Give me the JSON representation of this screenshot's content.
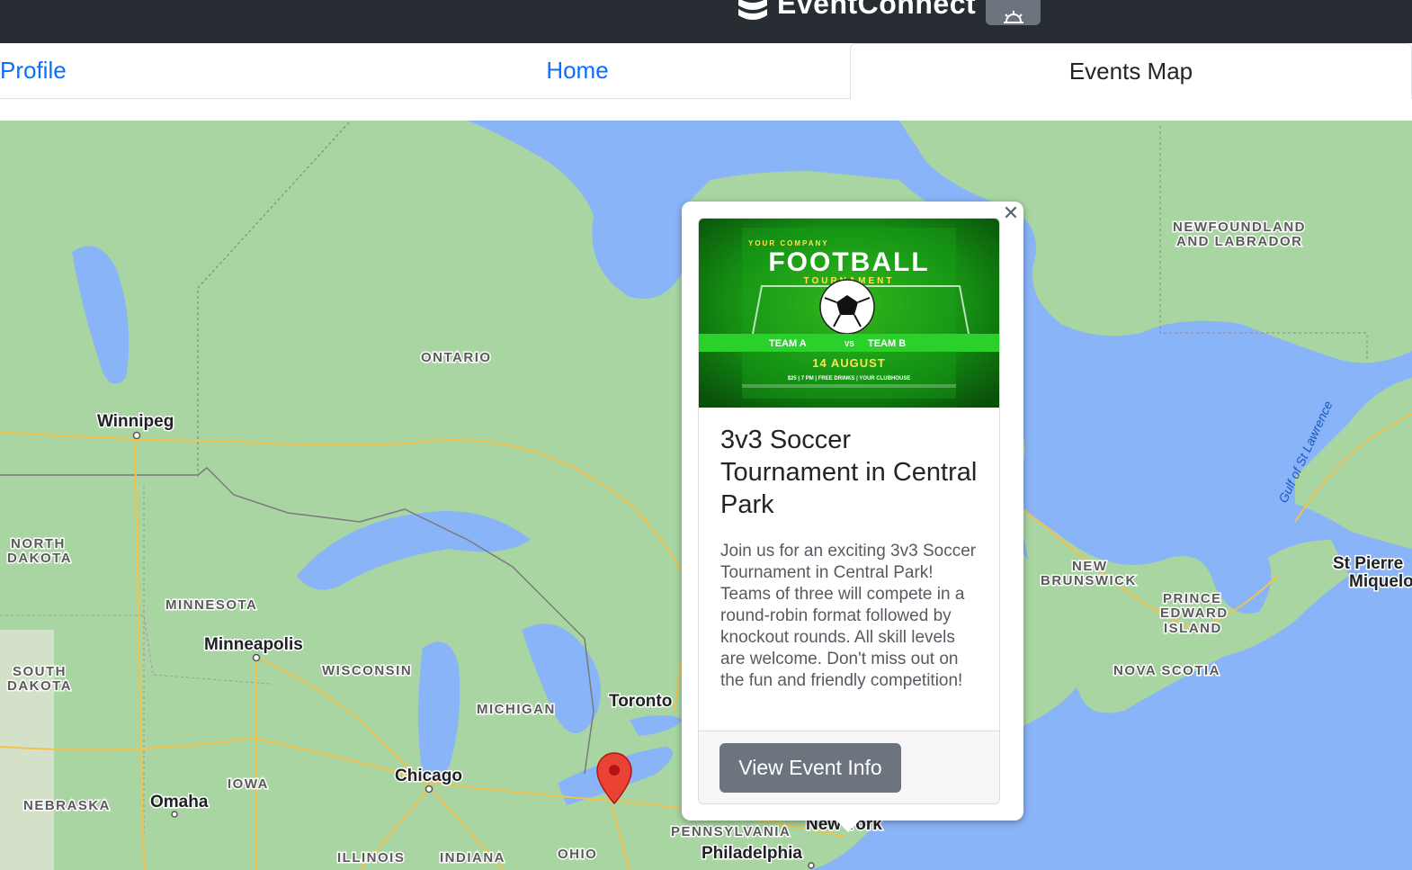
{
  "header": {
    "brand": "EventConnect",
    "logo_icon": "database-icon",
    "theme_icon": "sun-icon"
  },
  "tabs": [
    {
      "label": "Profile",
      "active": false
    },
    {
      "label": "Home",
      "active": false
    },
    {
      "label": "Events Map",
      "active": true
    }
  ],
  "map": {
    "regions": [
      "ONTARIO",
      "NEWFOUNDLAND",
      "AND LABRADOR",
      "NORTH",
      "DAKOTA",
      "MINNESOTA",
      "SOUTH",
      "DAKOTA",
      "WISCONSIN",
      "MICHIGAN",
      "IOWA",
      "NEBRASKA",
      "ILLINOIS",
      "INDIANA",
      "OHIO",
      "PENNSYLVANIA",
      "NEW",
      "BRUNSWICK",
      "PRINCE",
      "EDWARD",
      "ISLAND",
      "NOVA SCOTIA"
    ],
    "cities": [
      "Winnipeg",
      "Minneapolis",
      "Toronto",
      "Chicago",
      "Omaha",
      "Philadelphia",
      "New York",
      "St Pierre",
      "Miquelo"
    ],
    "water": [
      "Gulf of St Lawrence"
    ],
    "marker_icon": "map-pin-icon"
  },
  "popup": {
    "close_icon": "close-icon",
    "poster": {
      "company": "YOUR COMPANY",
      "title": "FOOTBALL",
      "subtitle": "TOURNAMENT",
      "team_a": "TEAM A",
      "vs": "VS",
      "team_b": "TEAM B",
      "date": "14 AUGUST",
      "details": "$25 | 7 PM | FREE DRINKS | YOUR CLUBHOUSE"
    },
    "title": "3v3 Soccer Tournament in Central Park",
    "description": "Join us for an exciting 3v3 Soccer Tournament in Central Park! Teams of three will compete in a round-robin format followed by knockout rounds. All skill levels are welcome. Don't miss out on the fun and friendly competition!",
    "button_label": "View Event Info"
  },
  "colors": {
    "topbar": "#282c33",
    "link": "#0d6efd",
    "water": "#8ab4f8",
    "land": "#a8d5a2",
    "button": "#6c757d",
    "marker": "#ea4335"
  }
}
